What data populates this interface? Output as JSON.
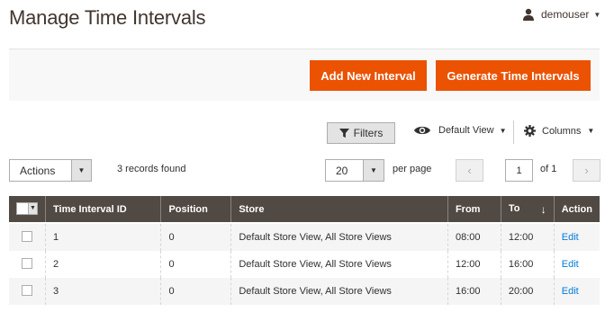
{
  "header": {
    "title": "Manage Time Intervals",
    "user": "demouser"
  },
  "action_bar": {
    "add_label": "Add New Interval",
    "generate_label": "Generate Time Intervals",
    "accent_color": "#eb5202"
  },
  "toolbar": {
    "filters_label": "Filters",
    "view_label": "Default View",
    "columns_label": "Columns",
    "actions_label": "Actions",
    "records_text": "3 records found",
    "per_page_value": "20",
    "per_page_label": "per page",
    "current_page": "1",
    "page_of": "of 1"
  },
  "grid": {
    "columns": [
      "Time Interval ID",
      "Position",
      "Store",
      "From",
      "To",
      "Action"
    ],
    "sorted_column": "To",
    "rows": [
      {
        "id": "1",
        "position": "0",
        "store": "Default Store View, All Store Views",
        "from": "08:00",
        "to": "12:00",
        "action": "Edit"
      },
      {
        "id": "2",
        "position": "0",
        "store": "Default Store View, All Store Views",
        "from": "12:00",
        "to": "16:00",
        "action": "Edit"
      },
      {
        "id": "3",
        "position": "0",
        "store": "Default Store View, All Store Views",
        "from": "16:00",
        "to": "20:00",
        "action": "Edit"
      }
    ]
  },
  "icons": {
    "user": "user-icon",
    "filter": "funnel-icon",
    "view": "eye-icon",
    "columns": "gear-icon",
    "sort": "arrow-down-icon"
  }
}
